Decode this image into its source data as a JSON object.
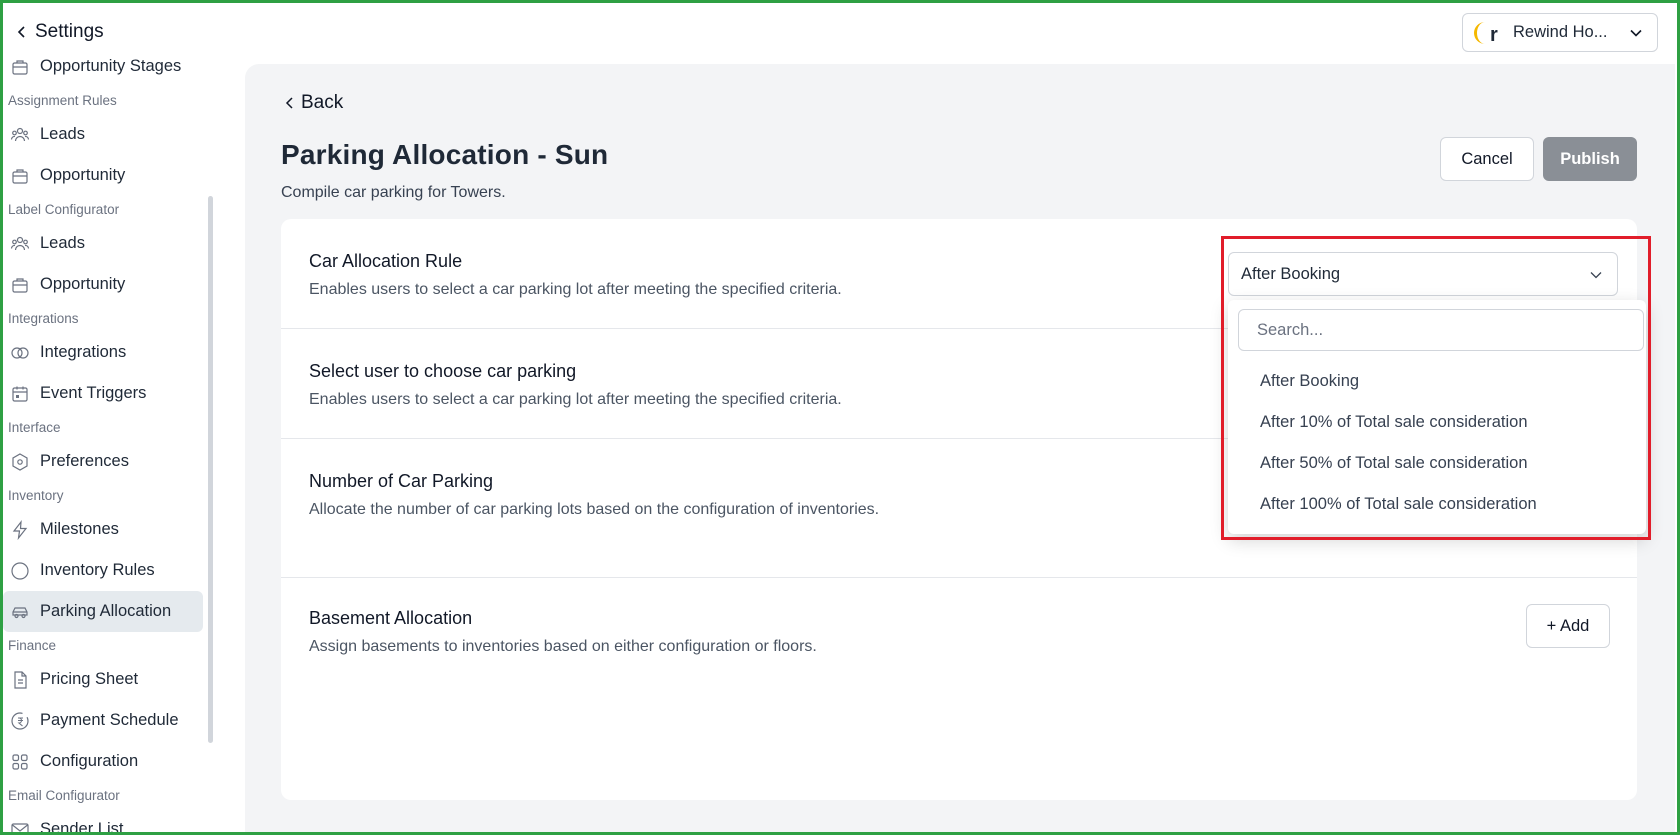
{
  "sidebar": {
    "header": "Settings",
    "items": [
      {
        "type": "item",
        "label": "Opportunity Stages",
        "icon": "briefcase-icon"
      },
      {
        "type": "section",
        "label": "Assignment Rules"
      },
      {
        "type": "item",
        "label": "Leads",
        "icon": "users-icon"
      },
      {
        "type": "item",
        "label": "Opportunity",
        "icon": "briefcase-icon"
      },
      {
        "type": "section",
        "label": "Label Configurator"
      },
      {
        "type": "item",
        "label": "Leads",
        "icon": "users-icon"
      },
      {
        "type": "item",
        "label": "Opportunity",
        "icon": "briefcase-icon"
      },
      {
        "type": "section",
        "label": "Integrations"
      },
      {
        "type": "item",
        "label": "Integrations",
        "icon": "rings-icon"
      },
      {
        "type": "item",
        "label": "Event Triggers",
        "icon": "calendar-icon"
      },
      {
        "type": "section",
        "label": "Interface"
      },
      {
        "type": "item",
        "label": "Preferences",
        "icon": "hexagon-icon"
      },
      {
        "type": "section",
        "label": "Inventory"
      },
      {
        "type": "item",
        "label": "Milestones",
        "icon": "bolt-icon"
      },
      {
        "type": "item",
        "label": "Inventory Rules",
        "icon": "circle-icon"
      },
      {
        "type": "item",
        "label": "Parking Allocation",
        "icon": "car-icon",
        "active": true
      },
      {
        "type": "section",
        "label": "Finance"
      },
      {
        "type": "item",
        "label": "Pricing Sheet",
        "icon": "document-icon"
      },
      {
        "type": "item",
        "label": "Payment Schedule",
        "icon": "rupee-clock-icon"
      },
      {
        "type": "item",
        "label": "Configuration",
        "icon": "grid-icon"
      },
      {
        "type": "section",
        "label": "Email Configurator"
      },
      {
        "type": "item",
        "label": "Sender List",
        "icon": "mail-icon"
      }
    ]
  },
  "topbar": {
    "org_name": "Rewind Ho...",
    "org_logo_letter": "r"
  },
  "page": {
    "back_label": "Back",
    "title": "Parking Allocation - Sun",
    "subtitle": "Compile car parking for Towers.",
    "cancel_label": "Cancel",
    "publish_label": "Publish"
  },
  "rows": {
    "car_rule": {
      "title": "Car Allocation Rule",
      "desc": "Enables users to select a car parking lot after meeting the specified criteria.",
      "selected": "After Booking"
    },
    "select_user": {
      "title": "Select user to choose car parking",
      "desc": "Enables users to select a car parking lot after meeting the specified criteria."
    },
    "num_parking": {
      "title": "Number of Car Parking",
      "desc": "Allocate the number of car parking lots based on the configuration of inventories."
    },
    "basement": {
      "title": "Basement Allocation",
      "desc": "Assign basements to inventories based on either configuration or floors.",
      "add_label": "+ Add"
    }
  },
  "dropdown": {
    "search_placeholder": "Search...",
    "options": [
      "After Booking",
      "After 10% of Total sale consideration",
      "After 50% of Total sale consideration",
      "After 100% of Total sale consideration"
    ]
  },
  "colors": {
    "accent_highlight": "#e11d2a",
    "frame": "#2ea043",
    "publish_bg": "#8a8f96",
    "logo_yellow": "#f5b800"
  }
}
